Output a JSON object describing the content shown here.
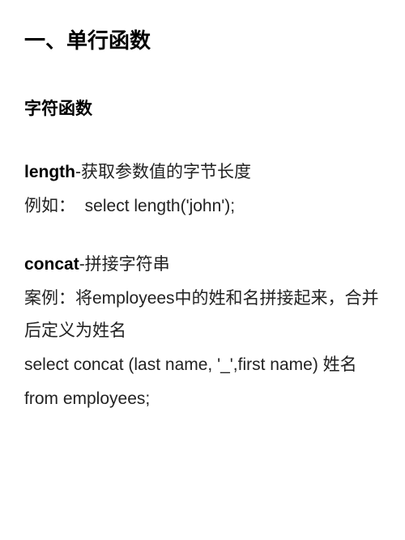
{
  "heading1": "一、单行函数",
  "heading2": "字符函数",
  "section_length": {
    "name": "length",
    "desc": "-获取参数值的字节长度",
    "example_label": "例如：",
    "example_code": "select length('john');"
  },
  "section_concat": {
    "name": "concat",
    "desc": "-拼接字符串",
    "case_label": "案例：",
    "case_text": "将employees中的姓和名拼接起来，合并后定义为姓名",
    "code_line1": "select concat (last name, '_',first name)  姓名",
    "code_line2": "from employees;"
  }
}
